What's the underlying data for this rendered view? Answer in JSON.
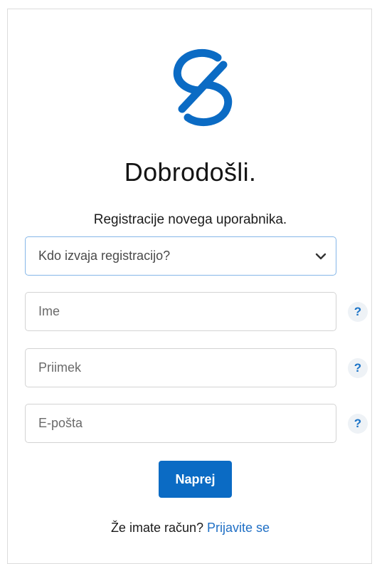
{
  "brand": {
    "logo_icon": "s-slash-logo-icon",
    "accent_color": "#0b6bc4"
  },
  "header": {
    "title": "Dobrodošli.",
    "subtitle": "Registracije novega uporabnika."
  },
  "form": {
    "registrant_select": {
      "selected": "Kdo izvaja registracijo?",
      "icon": "chevron-down-icon"
    },
    "first_name": {
      "placeholder": "Ime",
      "value": ""
    },
    "last_name": {
      "placeholder": "Priimek",
      "value": ""
    },
    "email": {
      "placeholder": "E-pošta",
      "value": ""
    },
    "help_label": "?",
    "submit_label": "Naprej"
  },
  "footer": {
    "prompt": "Že imate račun?",
    "login_link": "Prijavite se"
  }
}
